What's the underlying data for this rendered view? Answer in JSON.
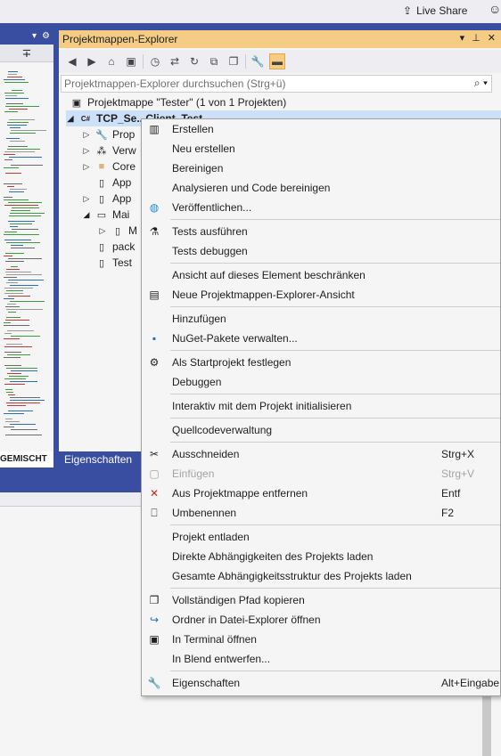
{
  "topbar": {
    "liveshare_label": "Live Share"
  },
  "left_panel": {
    "tab_label": "GEMISCHT"
  },
  "solution_explorer": {
    "title": "Projektmappen-Explorer",
    "search_placeholder": "Projektmappen-Explorer durchsuchen (Strg+ü)",
    "tree": [
      {
        "label": "Projektmappe \"Tester\" (1 von 1 Projekten)",
        "icon": "solution-icon"
      },
      {
        "label": "TCP_Se...Client_Test",
        "icon": "csharp-project-icon"
      },
      {
        "label": "Prop",
        "icon": "properties-icon"
      },
      {
        "label": "Verw",
        "icon": "references-icon"
      },
      {
        "label": "Core",
        "icon": "folder-icon"
      },
      {
        "label": "App",
        "icon": "file-icon"
      },
      {
        "label": "App",
        "icon": "file-icon"
      },
      {
        "label": "Mai",
        "icon": "file-icon"
      },
      {
        "label": "M",
        "icon": "file-icon"
      },
      {
        "label": "pack",
        "icon": "file-icon"
      },
      {
        "label": "Test",
        "icon": "file-icon"
      }
    ],
    "bottom_tabs": [
      "Eigenschaften"
    ]
  },
  "context_menu": {
    "items": [
      {
        "label": "Erstellen",
        "icon": "build-icon"
      },
      {
        "label": "Neu erstellen",
        "icon": ""
      },
      {
        "label": "Bereinigen",
        "icon": ""
      },
      {
        "label": "Analysieren und Code bereinigen",
        "icon": ""
      },
      {
        "label": "Veröffentlichen...",
        "icon": "globe-icon"
      },
      {
        "sep": true
      },
      {
        "label": "Tests ausführen",
        "icon": "flask-icon"
      },
      {
        "label": "Tests debuggen",
        "icon": ""
      },
      {
        "sep": true
      },
      {
        "label": "Ansicht auf dieses Element beschränken",
        "icon": ""
      },
      {
        "label": "Neue Projektmappen-Explorer-Ansicht",
        "icon": "new-view-icon"
      },
      {
        "sep": true
      },
      {
        "label": "Hinzufügen",
        "icon": ""
      },
      {
        "label": "NuGet-Pakete verwalten...",
        "icon": "nuget-icon"
      },
      {
        "sep": true
      },
      {
        "label": "Als Startprojekt festlegen",
        "icon": "gear-icon"
      },
      {
        "label": "Debuggen",
        "icon": ""
      },
      {
        "sep": true
      },
      {
        "label": "Interaktiv mit dem Projekt initialisieren",
        "icon": ""
      },
      {
        "sep": true
      },
      {
        "label": "Quellcodeverwaltung",
        "icon": ""
      },
      {
        "sep": true
      },
      {
        "label": "Ausschneiden",
        "icon": "scissors-icon",
        "shortcut": "Strg+X"
      },
      {
        "label": "Einfügen",
        "icon": "paste-icon",
        "shortcut": "Strg+V",
        "disabled": true
      },
      {
        "label": "Aus Projektmappe entfernen",
        "icon": "remove-icon",
        "shortcut": "Entf"
      },
      {
        "label": "Umbenennen",
        "icon": "rename-icon",
        "shortcut": "F2"
      },
      {
        "sep": true
      },
      {
        "label": "Projekt entladen",
        "icon": ""
      },
      {
        "label": "Direkte Abhängigkeiten des Projekts laden",
        "icon": ""
      },
      {
        "label": "Gesamte Abhängigkeitsstruktur des Projekts laden",
        "icon": ""
      },
      {
        "sep": true
      },
      {
        "label": "Vollständigen Pfad kopieren",
        "icon": "copy-icon"
      },
      {
        "label": "Ordner in Datei-Explorer öffnen",
        "icon": "open-folder-icon"
      },
      {
        "label": "In Terminal öffnen",
        "icon": "terminal-icon"
      },
      {
        "label": "In Blend entwerfen...",
        "icon": ""
      },
      {
        "sep": true
      },
      {
        "label": "Eigenschaften",
        "icon": "wrench-icon",
        "shortcut": "Alt+Eingabe"
      }
    ]
  },
  "colors": {
    "frame_blue": "#3a4ea1",
    "title_active": "#f5cc84",
    "menu_bg": "#f5f5f5",
    "selection": "#cce0f7"
  }
}
